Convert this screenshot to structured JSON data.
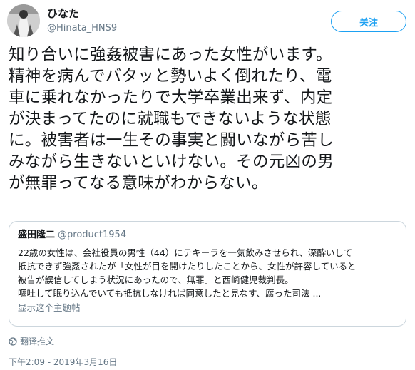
{
  "author": {
    "display_name": "ひなた",
    "handle": "@Hinata_HNS9"
  },
  "follow_button": {
    "label": "关注"
  },
  "tweet": {
    "text": "知り合いに強姦被害にあった女性がいます。\n精神を病んでバタッと勢いよく倒れたり、電\n車に乗れなかったりで大学卒業出来ず、内定\nが決まってたのに就職もできないような状態\nに。被害者は一生その事実と闘いながら苦し\nみながら生きないといけない。その元凶の男\nが無罪ってなる意味がわからない。"
  },
  "quoted_tweet": {
    "name": "盛田隆二",
    "handle": "@product1954",
    "text": "22歳の女性は、会社役員の男性（44）にテキーラを一気飲みさせられ、深酔いして\n抵抗できず強姦されたが「女性が目を開けたりしたことから、女性が許容していると\n被告が誤信してしまう状況にあったので、無罪」と西崎健児裁判長。\n嘔吐して眠り込んでいても抵抗しなければ同意したと見なす、腐った司法 ...",
    "show_thread_label": "显示这个主题帖"
  },
  "translate_label": "翻译推文",
  "timestamp": "下午2:09 - 2019年3月16日",
  "colors": {
    "accent": "#1da1f2",
    "muted": "#657786",
    "border": "#ccd6dd"
  },
  "icons": {
    "translate": "globe-icon"
  }
}
